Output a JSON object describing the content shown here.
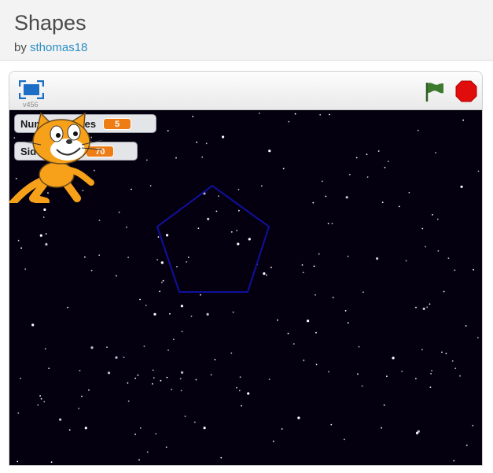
{
  "project": {
    "title": "Shapes",
    "by_label": "by",
    "author": "sthomas18"
  },
  "player": {
    "version": "v456",
    "icons": {
      "fullscreen": "fullscreen-icon",
      "green_flag": "green-flag-icon",
      "stop": "stop-sign-icon"
    },
    "colors": {
      "stage_background": "#05000f",
      "monitor_value": "#ee7d16",
      "pen": "#1010a0",
      "flag": "#3c7a2e",
      "stop": "#e10d0d",
      "fullscreen": "#1c6fc5"
    }
  },
  "monitors": [
    {
      "label": "NumberofSides",
      "value": "5"
    },
    {
      "label": "Side Length",
      "value": "70"
    }
  ],
  "drawing": {
    "shape": "pentagon",
    "sides": 5,
    "side_length": 70
  },
  "sprite": {
    "name": "scratch-cat"
  }
}
